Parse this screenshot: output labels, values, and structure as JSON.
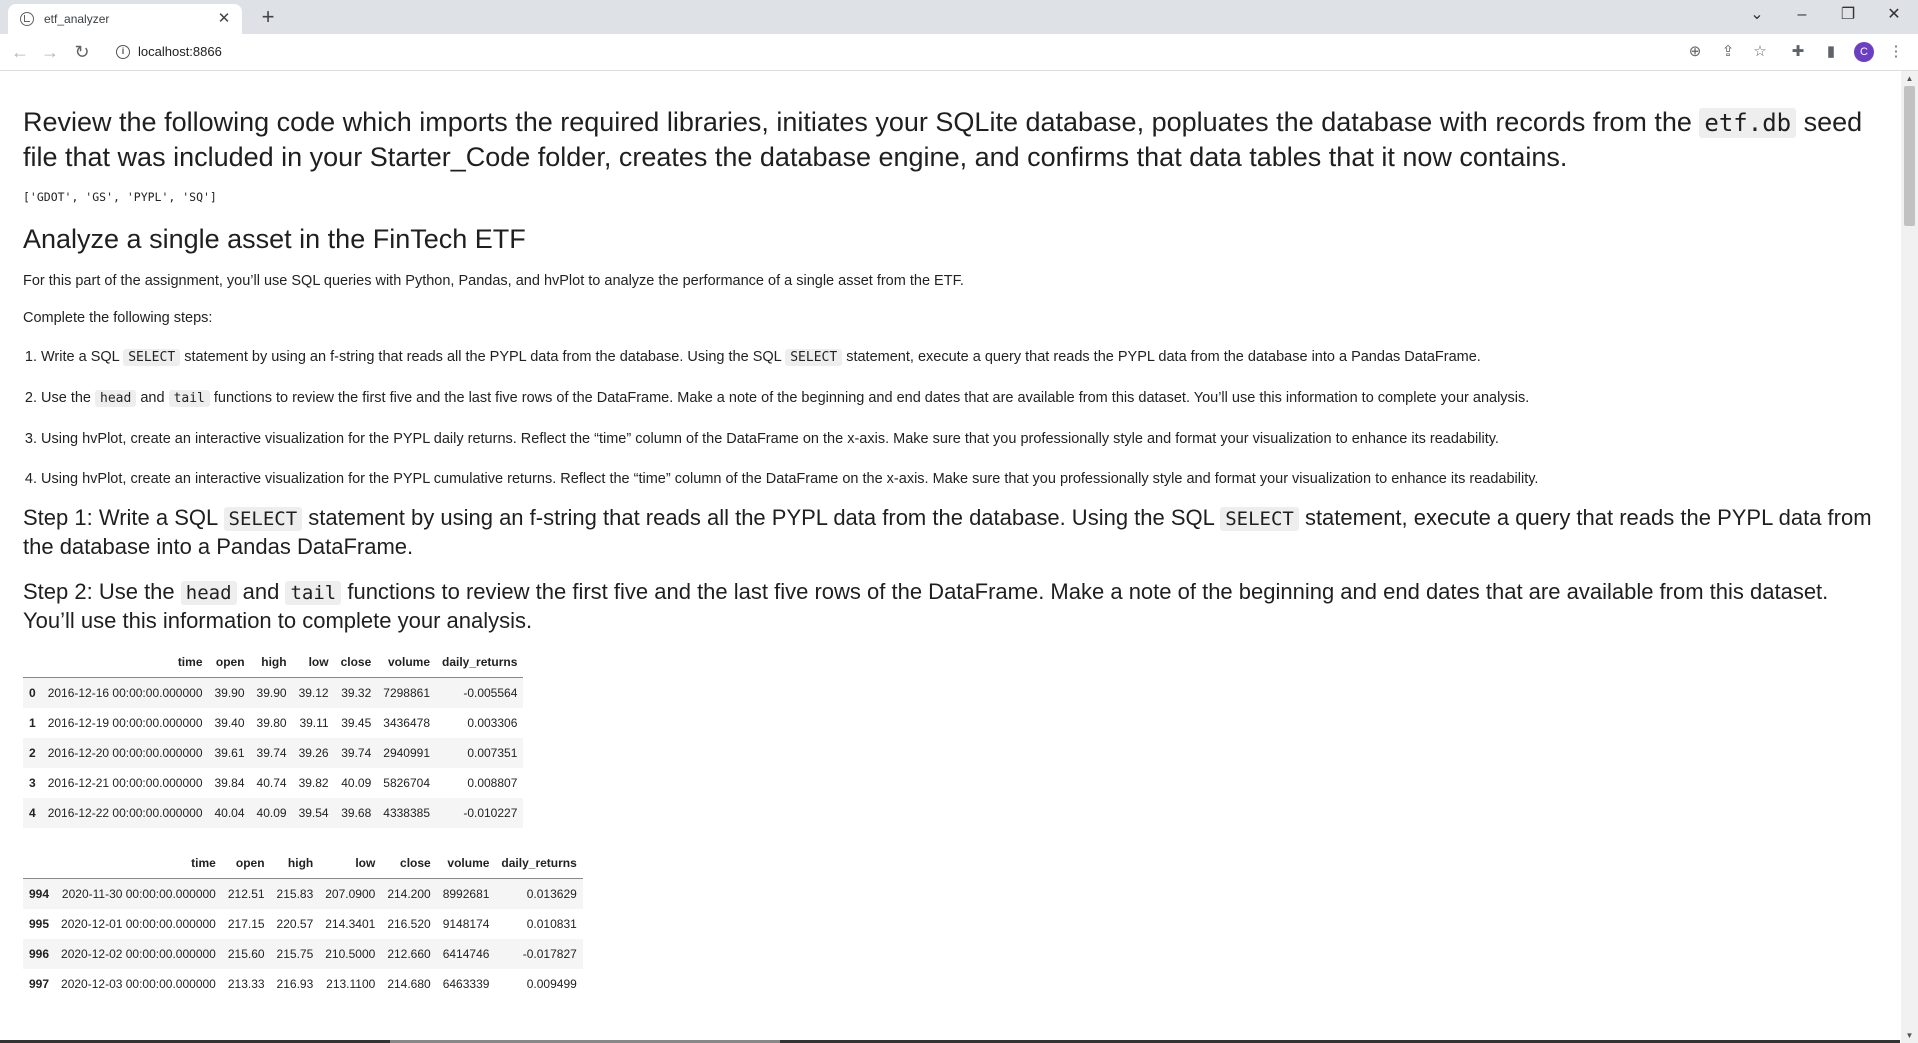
{
  "browser": {
    "tab_title": "etf_analyzer",
    "url": "localhost:8866",
    "avatar_letter": "C"
  },
  "notebook": {
    "intro_heading_before": "Review the following code which imports the required libraries, initiates your SQLite database, popluates the database with records from the ",
    "intro_heading_code": "etf.db",
    "intro_heading_after": " seed file that was included in your Starter_Code folder, creates the database engine, and confirms that data tables that it now contains.",
    "tables_output": "['GDOT', 'GS', 'PYPL', 'SQ']",
    "section_heading": "Analyze a single asset in the FinTech ETF",
    "intro_paragraph": "For this part of the assignment, you’ll use SQL queries with Python, Pandas, and hvPlot to analyze the performance of a single asset from the ETF.",
    "steps_intro": "Complete the following steps:",
    "steps": [
      {
        "pre": "Write a SQL ",
        "code1": "SELECT",
        "mid": " statement by using an f-string that reads all the PYPL data from the database. Using the SQL ",
        "code2": "SELECT",
        "post": " statement, execute a query that reads the PYPL data from the database into a Pandas DataFrame."
      },
      {
        "pre": "Use the ",
        "code1": "head",
        "mid": " and ",
        "code2": "tail",
        "post": " functions to review the first five and the last five rows of the DataFrame. Make a note of the beginning and end dates that are available from this dataset. You’ll use this information to complete your analysis."
      },
      {
        "text": "Using hvPlot, create an interactive visualization for the PYPL daily returns. Reflect the “time” column of the DataFrame on the x-axis. Make sure that you professionally style and format your visualization to enhance its readability."
      },
      {
        "text": "Using hvPlot, create an interactive visualization for the PYPL cumulative returns. Reflect the “time” column of the DataFrame on the x-axis. Make sure that you professionally style and format your visualization to enhance its readability."
      }
    ],
    "step1_heading": {
      "pre": "Step 1: Write a SQL ",
      "code1": "SELECT",
      "mid": " statement by using an f-string that reads all the PYPL data from the database. Using the SQL ",
      "code2": "SELECT",
      "post": " statement, execute a query that reads the PYPL data from the database into a Pandas DataFrame."
    },
    "step2_heading": {
      "pre": "Step 2: Use the ",
      "code1": "head",
      "mid": " and ",
      "code2": "tail",
      "post": " functions to review the first five and the last five rows of the DataFrame. Make a note of the beginning and end dates that are available from this dataset. You’ll use this information to complete your analysis."
    }
  },
  "head_table": {
    "columns": [
      "",
      "time",
      "open",
      "high",
      "low",
      "close",
      "volume",
      "daily_returns"
    ],
    "rows": [
      [
        "0",
        "2016-12-16 00:00:00.000000",
        "39.90",
        "39.90",
        "39.12",
        "39.32",
        "7298861",
        "-0.005564"
      ],
      [
        "1",
        "2016-12-19 00:00:00.000000",
        "39.40",
        "39.80",
        "39.11",
        "39.45",
        "3436478",
        "0.003306"
      ],
      [
        "2",
        "2016-12-20 00:00:00.000000",
        "39.61",
        "39.74",
        "39.26",
        "39.74",
        "2940991",
        "0.007351"
      ],
      [
        "3",
        "2016-12-21 00:00:00.000000",
        "39.84",
        "40.74",
        "39.82",
        "40.09",
        "5826704",
        "0.008807"
      ],
      [
        "4",
        "2016-12-22 00:00:00.000000",
        "40.04",
        "40.09",
        "39.54",
        "39.68",
        "4338385",
        "-0.010227"
      ]
    ]
  },
  "tail_table": {
    "columns": [
      "",
      "time",
      "open",
      "high",
      "low",
      "close",
      "volume",
      "daily_returns"
    ],
    "rows": [
      [
        "994",
        "2020-11-30 00:00:00.000000",
        "212.51",
        "215.83",
        "207.0900",
        "214.200",
        "8992681",
        "0.013629"
      ],
      [
        "995",
        "2020-12-01 00:00:00.000000",
        "217.15",
        "220.57",
        "214.3401",
        "216.520",
        "9148174",
        "0.010831"
      ],
      [
        "996",
        "2020-12-02 00:00:00.000000",
        "215.60",
        "215.75",
        "210.5000",
        "212.660",
        "6414746",
        "-0.017827"
      ],
      [
        "997",
        "2020-12-03 00:00:00.000000",
        "213.33",
        "216.93",
        "213.1100",
        "214.680",
        "6463339",
        "0.009499"
      ]
    ]
  }
}
